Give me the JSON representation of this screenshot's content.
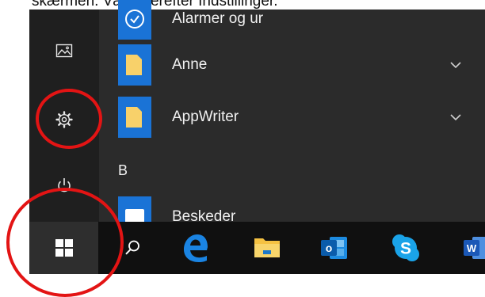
{
  "caption": "skærmen. Vælg derefter Indstillinger.",
  "colors": {
    "menu_bg": "#2b2b2b",
    "rail_bg": "#1f1f1f",
    "taskbar_bg": "#101010",
    "tile_blue": "#1a73d6",
    "folder_yellow": "#f8d16a",
    "annotation_red": "#e31414"
  },
  "rail": [
    {
      "name": "pictures",
      "icon": "image-icon"
    },
    {
      "name": "settings",
      "icon": "gear-icon"
    },
    {
      "name": "power",
      "icon": "power-icon"
    }
  ],
  "apps": [
    {
      "label": "Alarmer og ur",
      "icon": "clock-icon"
    },
    {
      "label": "Anne",
      "icon": "folder-icon",
      "expandable": true
    },
    {
      "label": "AppWriter",
      "icon": "folder-icon",
      "expandable": true
    }
  ],
  "section_letter": "B",
  "partial_app": {
    "label": "Beskeder",
    "icon": "messaging-icon"
  },
  "taskbar": [
    {
      "name": "start",
      "icon": "windows-logo-icon"
    },
    {
      "name": "search",
      "icon": "search-icon"
    },
    {
      "name": "edge",
      "icon": "edge-icon"
    },
    {
      "name": "file-explorer",
      "icon": "folder-icon"
    },
    {
      "name": "outlook",
      "icon": "outlook-icon",
      "letter": "o"
    },
    {
      "name": "skype",
      "icon": "skype-icon",
      "letter": "S"
    },
    {
      "name": "word",
      "icon": "word-icon",
      "letter": "W"
    }
  ],
  "annotations": [
    {
      "shape": "circle",
      "target": "settings"
    },
    {
      "shape": "circle",
      "target": "start"
    }
  ]
}
